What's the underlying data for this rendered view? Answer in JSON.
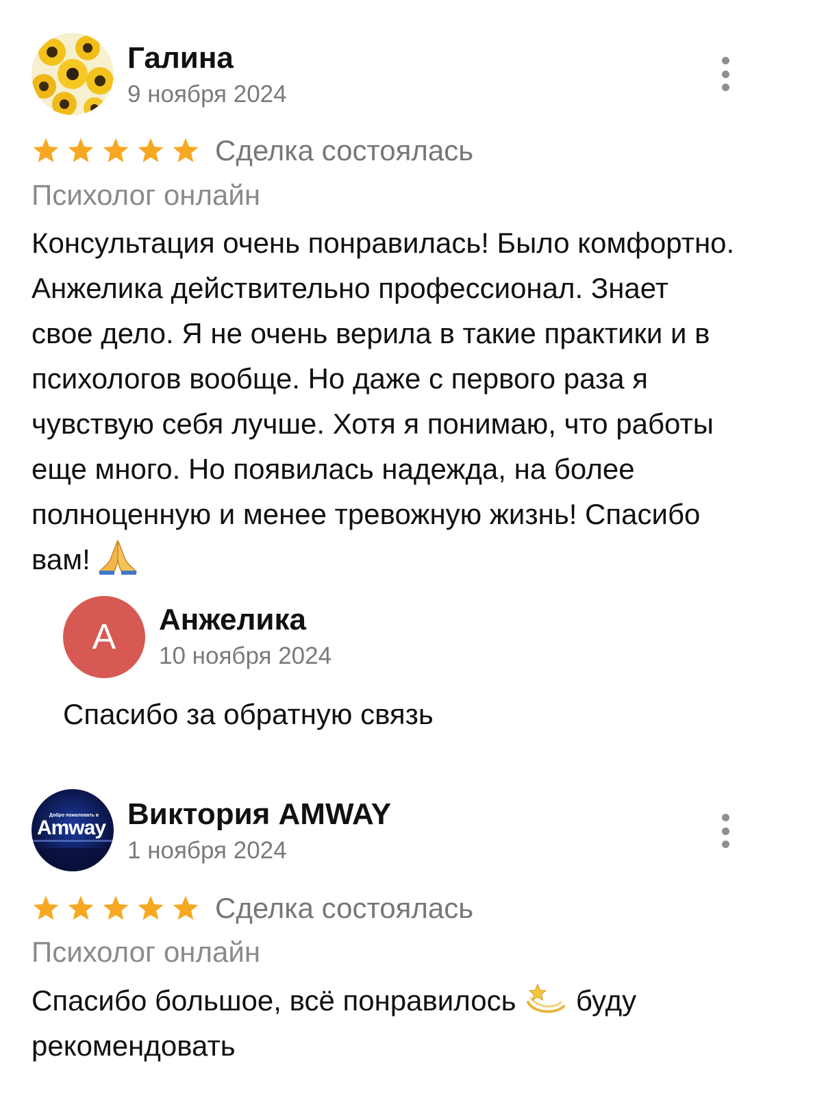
{
  "reviews": [
    {
      "author": "Галина",
      "date": "9 ноября 2024",
      "rating": 5,
      "deal_status": "Сделка состоялась",
      "service": "Психолог онлайн",
      "text": "Консультация очень понравилась! Было комфортно. Анжелика действительно профессионал. Знает свое дело. Я не очень верила в такие практики и в психологов вообще. Но даже с первого раза я чувствую себя лучше. Хотя я понимаю, что работы еще много. Но появилась надежда, на более полноценную и менее тревожную жизнь! Спасибо вам!",
      "avatar_icon": "sunflowers-avatar",
      "reply": {
        "author": "Анжелика",
        "initial": "А",
        "date": "10 ноября 2024",
        "text": "Спасибо за обратную связь",
        "avatar_color": "#d65a53"
      }
    },
    {
      "author": "Виктория AMWAY",
      "date": "1 ноября 2024",
      "rating": 5,
      "deal_status": "Сделка состоялась",
      "service": "Психолог онлайн",
      "text_part1": "Спасибо большое, всё понравилось",
      "text_part2": "буду рекомендовать",
      "avatar_icon": "amway-logo-avatar",
      "avatar_logo_text": "Amway",
      "avatar_logo_small": "Добро пожаловать в"
    }
  ],
  "colors": {
    "star": "#f7a823",
    "muted": "#7a7a7a"
  }
}
